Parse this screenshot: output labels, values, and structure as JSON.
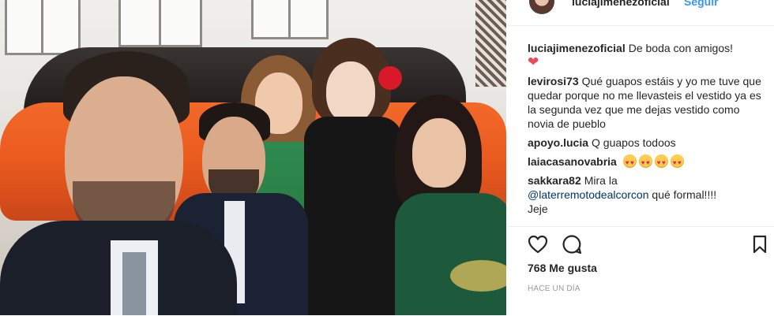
{
  "header": {
    "username": "luciajimenezoficial",
    "follow_label": "Seguir"
  },
  "comments": [
    {
      "user": "luciajimenezoficial",
      "text": "De boda con amigos!",
      "extra": "❤"
    },
    {
      "user": "levirosi73",
      "text": "Qué guapos estáis y yo me tuve que quedar porque no me llevasteis el vestido ya es la segunda vez que me dejas vestido como novia de pueblo"
    },
    {
      "user": "apoyo.lucia",
      "text": "Q guapos todoos"
    },
    {
      "user": "laiacasanovabria",
      "emoji_count": 4
    },
    {
      "user": "sakkara82",
      "text_before": "Mira la",
      "mention": "@laterremotodealcorcon",
      "text_after": "qué formal!!!!",
      "continuation": "Jeje"
    }
  ],
  "actions": {
    "like_icon": "heart-outline-icon",
    "comment_icon": "comment-bubble-icon",
    "save_icon": "bookmark-icon",
    "likes_text": "768 Me gusta",
    "timestamp": "HACE UN DÍA"
  },
  "colors": {
    "link": "#003569",
    "follow": "#3897f0",
    "heart": "#ed4956",
    "car": "#ea5a1e"
  }
}
